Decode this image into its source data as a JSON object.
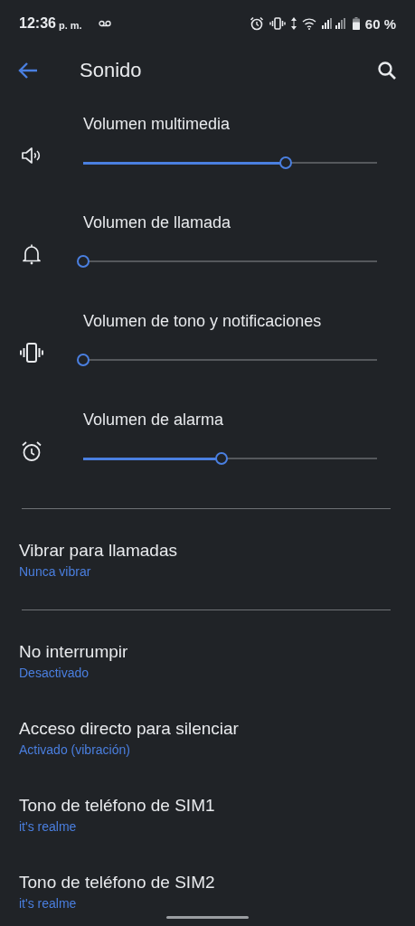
{
  "status_bar": {
    "time": "12:36",
    "am_pm": "p. m.",
    "battery": "60 %"
  },
  "toolbar": {
    "title": "Sonido"
  },
  "volume_sliders": [
    {
      "kind": "media",
      "label": "Volumen multimedia",
      "level": 0.69
    },
    {
      "kind": "ring",
      "label": "Volumen de llamada",
      "level": 0
    },
    {
      "kind": "notification",
      "label": "Volumen de tono y notificaciones",
      "level": 0
    },
    {
      "kind": "alarm",
      "label": "Volumen de alarma",
      "level": 0.47
    }
  ],
  "setting_groups": [
    [
      {
        "title": "Vibrar para llamadas",
        "summary": "Nunca vibrar"
      }
    ],
    [
      {
        "title": "No interrumpir",
        "summary": "Desactivado"
      },
      {
        "title": "Acceso directo para silenciar",
        "summary": "Activado (vibración)"
      },
      {
        "title": "Tono de teléfono de SIM1",
        "summary": "it's realme"
      },
      {
        "title": "Tono de teléfono de SIM2",
        "summary": "it's realme"
      }
    ]
  ]
}
